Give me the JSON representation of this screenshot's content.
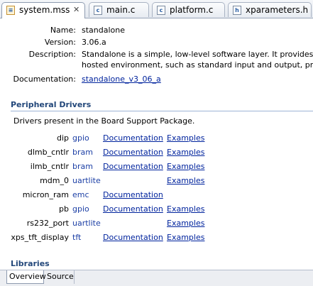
{
  "tabs": [
    {
      "label": "system.mss",
      "icon": "mss-file-icon",
      "active": true,
      "closable": true
    },
    {
      "label": "main.c",
      "icon": "c-file-icon"
    },
    {
      "label": "platform.c",
      "icon": "c-file-icon"
    },
    {
      "label": "xparameters.h",
      "icon": "h-file-icon"
    }
  ],
  "os": {
    "name_label": "Name:",
    "name": "standalone",
    "version_label": "Version:",
    "version": "3.06.a",
    "description_label": "Description:",
    "description_line1": "Standalone is a simple, low-level software layer. It provides access",
    "description_line2": "hosted environment, such as standard input and output, profiling",
    "documentation_label": "Documentation:",
    "documentation_link": "standalone_v3_06_a"
  },
  "peripheral": {
    "heading": "Peripheral Drivers",
    "intro": "Drivers present in the Board Support Package.",
    "rows": [
      {
        "name": "dip",
        "driver": "gpio",
        "doc": "Documentation",
        "examples": "Examples"
      },
      {
        "name": "dlmb_cntlr",
        "driver": "bram",
        "doc": "Documentation",
        "examples": "Examples"
      },
      {
        "name": "ilmb_cntlr",
        "driver": "bram",
        "doc": "Documentation",
        "examples": "Examples"
      },
      {
        "name": "mdm_0",
        "driver": "uartlite",
        "doc": "",
        "examples": "Examples"
      },
      {
        "name": "micron_ram",
        "driver": "emc",
        "doc": "Documentation",
        "examples": ""
      },
      {
        "name": "pb",
        "driver": "gpio",
        "doc": "Documentation",
        "examples": "Examples"
      },
      {
        "name": "rs232_port",
        "driver": "uartlite",
        "doc": "",
        "examples": "Examples"
      },
      {
        "name": "xps_tft_display",
        "driver": "tft",
        "doc": "Documentation",
        "examples": "Examples"
      }
    ]
  },
  "libraries": {
    "heading": "Libraries"
  },
  "bottom_tabs": [
    {
      "label": "Overview",
      "active": true
    },
    {
      "label": "Source",
      "active": false
    }
  ]
}
